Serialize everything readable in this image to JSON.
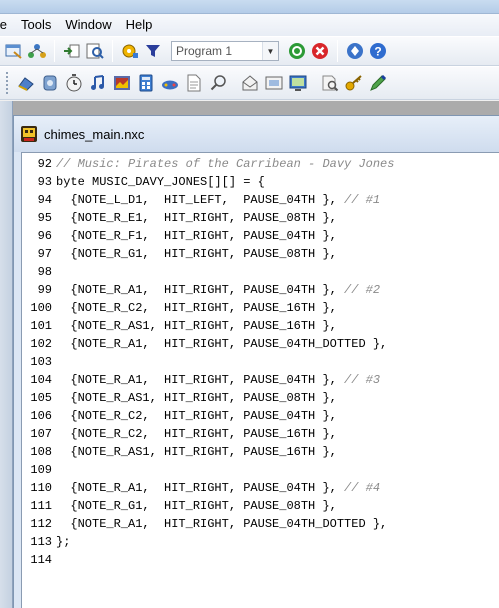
{
  "menu": {
    "items": [
      "ile",
      "Tools",
      "Window",
      "Help"
    ]
  },
  "toolbar": {
    "program_combo": {
      "value": "Program 1"
    },
    "row1_icons": [
      "window-icon",
      "tree-icon",
      "diagram-icon",
      "find-icon",
      "settings-icon",
      "filter-icon",
      "compile-icon",
      "stop-icon",
      "diamond-icon",
      "help-icon"
    ],
    "row2_icons": [
      "brick-icon",
      "motor-icon",
      "clock-icon",
      "music-icon",
      "image-icon",
      "calculator-icon",
      "joystick-icon",
      "file-icon",
      "magnify-icon",
      "mail-icon",
      "screen-icon",
      "monitor-icon",
      "zoom-icon",
      "key-icon",
      "pen-icon"
    ]
  },
  "editor": {
    "filename": "chimes_main.nxc",
    "lines": [
      {
        "num": "92",
        "code": "",
        "comment": "// Music: Pirates of the Carribean - Davy Jones"
      },
      {
        "num": "93",
        "code": "byte MUSIC_DAVY_JONES[][] = {",
        "comment": ""
      },
      {
        "num": "94",
        "code": "  {NOTE_L_D1,  HIT_LEFT,  PAUSE_04TH }, ",
        "comment": "// #1"
      },
      {
        "num": "95",
        "code": "  {NOTE_R_E1,  HIT_RIGHT, PAUSE_08TH },",
        "comment": ""
      },
      {
        "num": "96",
        "code": "  {NOTE_R_F1,  HIT_RIGHT, PAUSE_04TH },",
        "comment": ""
      },
      {
        "num": "97",
        "code": "  {NOTE_R_G1,  HIT_RIGHT, PAUSE_08TH },",
        "comment": ""
      },
      {
        "num": "98",
        "code": "",
        "comment": ""
      },
      {
        "num": "99",
        "code": "  {NOTE_R_A1,  HIT_RIGHT, PAUSE_04TH }, ",
        "comment": "// #2"
      },
      {
        "num": "100",
        "code": "  {NOTE_R_C2,  HIT_RIGHT, PAUSE_16TH },",
        "comment": ""
      },
      {
        "num": "101",
        "code": "  {NOTE_R_AS1, HIT_RIGHT, PAUSE_16TH },",
        "comment": ""
      },
      {
        "num": "102",
        "code": "  {NOTE_R_A1,  HIT_RIGHT, PAUSE_04TH_DOTTED },",
        "comment": ""
      },
      {
        "num": "103",
        "code": "",
        "comment": ""
      },
      {
        "num": "104",
        "code": "  {NOTE_R_A1,  HIT_RIGHT, PAUSE_04TH }, ",
        "comment": "// #3"
      },
      {
        "num": "105",
        "code": "  {NOTE_R_AS1, HIT_RIGHT, PAUSE_08TH },",
        "comment": ""
      },
      {
        "num": "106",
        "code": "  {NOTE_R_C2,  HIT_RIGHT, PAUSE_04TH },",
        "comment": ""
      },
      {
        "num": "107",
        "code": "  {NOTE_R_C2,  HIT_RIGHT, PAUSE_16TH },",
        "comment": ""
      },
      {
        "num": "108",
        "code": "  {NOTE_R_AS1, HIT_RIGHT, PAUSE_16TH },",
        "comment": ""
      },
      {
        "num": "109",
        "code": "",
        "comment": ""
      },
      {
        "num": "110",
        "code": "  {NOTE_R_A1,  HIT_RIGHT, PAUSE_04TH }, ",
        "comment": "// #4"
      },
      {
        "num": "111",
        "code": "  {NOTE_R_G1,  HIT_RIGHT, PAUSE_08TH },",
        "comment": ""
      },
      {
        "num": "112",
        "code": "  {NOTE_R_A1,  HIT_RIGHT, PAUSE_04TH_DOTTED },",
        "comment": ""
      },
      {
        "num": "113",
        "code": "};",
        "comment": ""
      },
      {
        "num": "114",
        "code": "",
        "comment": ""
      }
    ]
  }
}
